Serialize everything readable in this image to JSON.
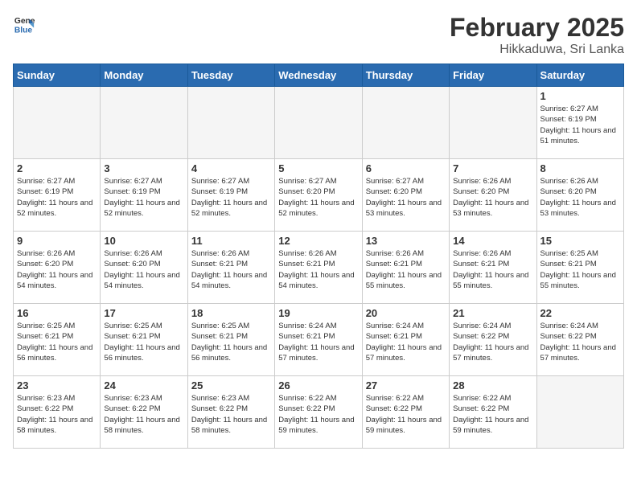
{
  "header": {
    "logo_general": "General",
    "logo_blue": "Blue",
    "title": "February 2025",
    "subtitle": "Hikkaduwa, Sri Lanka"
  },
  "days_of_week": [
    "Sunday",
    "Monday",
    "Tuesday",
    "Wednesday",
    "Thursday",
    "Friday",
    "Saturday"
  ],
  "weeks": [
    [
      {
        "day": "",
        "info": "",
        "empty": true
      },
      {
        "day": "",
        "info": "",
        "empty": true
      },
      {
        "day": "",
        "info": "",
        "empty": true
      },
      {
        "day": "",
        "info": "",
        "empty": true
      },
      {
        "day": "",
        "info": "",
        "empty": true
      },
      {
        "day": "",
        "info": "",
        "empty": true
      },
      {
        "day": "1",
        "info": "Sunrise: 6:27 AM\nSunset: 6:19 PM\nDaylight: 11 hours and 51 minutes."
      }
    ],
    [
      {
        "day": "2",
        "info": "Sunrise: 6:27 AM\nSunset: 6:19 PM\nDaylight: 11 hours and 52 minutes."
      },
      {
        "day": "3",
        "info": "Sunrise: 6:27 AM\nSunset: 6:19 PM\nDaylight: 11 hours and 52 minutes."
      },
      {
        "day": "4",
        "info": "Sunrise: 6:27 AM\nSunset: 6:19 PM\nDaylight: 11 hours and 52 minutes."
      },
      {
        "day": "5",
        "info": "Sunrise: 6:27 AM\nSunset: 6:20 PM\nDaylight: 11 hours and 52 minutes."
      },
      {
        "day": "6",
        "info": "Sunrise: 6:27 AM\nSunset: 6:20 PM\nDaylight: 11 hours and 53 minutes."
      },
      {
        "day": "7",
        "info": "Sunrise: 6:26 AM\nSunset: 6:20 PM\nDaylight: 11 hours and 53 minutes."
      },
      {
        "day": "8",
        "info": "Sunrise: 6:26 AM\nSunset: 6:20 PM\nDaylight: 11 hours and 53 minutes."
      }
    ],
    [
      {
        "day": "9",
        "info": "Sunrise: 6:26 AM\nSunset: 6:20 PM\nDaylight: 11 hours and 54 minutes."
      },
      {
        "day": "10",
        "info": "Sunrise: 6:26 AM\nSunset: 6:20 PM\nDaylight: 11 hours and 54 minutes."
      },
      {
        "day": "11",
        "info": "Sunrise: 6:26 AM\nSunset: 6:21 PM\nDaylight: 11 hours and 54 minutes."
      },
      {
        "day": "12",
        "info": "Sunrise: 6:26 AM\nSunset: 6:21 PM\nDaylight: 11 hours and 54 minutes."
      },
      {
        "day": "13",
        "info": "Sunrise: 6:26 AM\nSunset: 6:21 PM\nDaylight: 11 hours and 55 minutes."
      },
      {
        "day": "14",
        "info": "Sunrise: 6:26 AM\nSunset: 6:21 PM\nDaylight: 11 hours and 55 minutes."
      },
      {
        "day": "15",
        "info": "Sunrise: 6:25 AM\nSunset: 6:21 PM\nDaylight: 11 hours and 55 minutes."
      }
    ],
    [
      {
        "day": "16",
        "info": "Sunrise: 6:25 AM\nSunset: 6:21 PM\nDaylight: 11 hours and 56 minutes."
      },
      {
        "day": "17",
        "info": "Sunrise: 6:25 AM\nSunset: 6:21 PM\nDaylight: 11 hours and 56 minutes."
      },
      {
        "day": "18",
        "info": "Sunrise: 6:25 AM\nSunset: 6:21 PM\nDaylight: 11 hours and 56 minutes."
      },
      {
        "day": "19",
        "info": "Sunrise: 6:24 AM\nSunset: 6:21 PM\nDaylight: 11 hours and 57 minutes."
      },
      {
        "day": "20",
        "info": "Sunrise: 6:24 AM\nSunset: 6:21 PM\nDaylight: 11 hours and 57 minutes."
      },
      {
        "day": "21",
        "info": "Sunrise: 6:24 AM\nSunset: 6:22 PM\nDaylight: 11 hours and 57 minutes."
      },
      {
        "day": "22",
        "info": "Sunrise: 6:24 AM\nSunset: 6:22 PM\nDaylight: 11 hours and 57 minutes."
      }
    ],
    [
      {
        "day": "23",
        "info": "Sunrise: 6:23 AM\nSunset: 6:22 PM\nDaylight: 11 hours and 58 minutes."
      },
      {
        "day": "24",
        "info": "Sunrise: 6:23 AM\nSunset: 6:22 PM\nDaylight: 11 hours and 58 minutes."
      },
      {
        "day": "25",
        "info": "Sunrise: 6:23 AM\nSunset: 6:22 PM\nDaylight: 11 hours and 58 minutes."
      },
      {
        "day": "26",
        "info": "Sunrise: 6:22 AM\nSunset: 6:22 PM\nDaylight: 11 hours and 59 minutes."
      },
      {
        "day": "27",
        "info": "Sunrise: 6:22 AM\nSunset: 6:22 PM\nDaylight: 11 hours and 59 minutes."
      },
      {
        "day": "28",
        "info": "Sunrise: 6:22 AM\nSunset: 6:22 PM\nDaylight: 11 hours and 59 minutes."
      },
      {
        "day": "",
        "info": "",
        "empty": true
      }
    ]
  ]
}
